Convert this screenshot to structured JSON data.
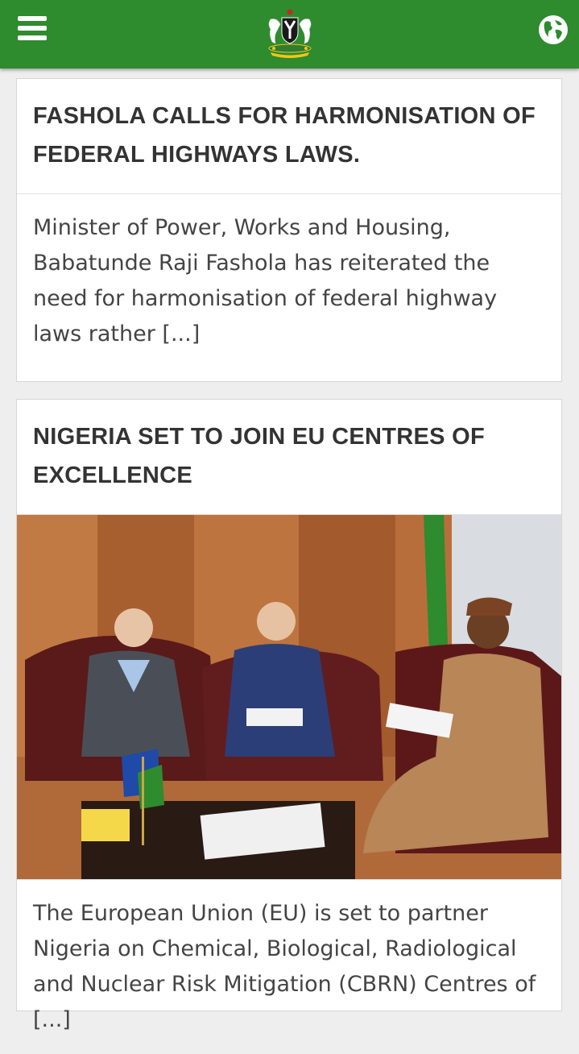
{
  "header": {
    "menu_icon": "hamburger-menu-icon",
    "logo": "nigeria-coat-of-arms-logo",
    "language_icon": "globe-icon",
    "brand_color": "#2e8b2e"
  },
  "articles": [
    {
      "title": "FASHOLA CALLS FOR HARMONISATION OF FEDERAL HIGHWAYS LAWS.",
      "excerpt": "Minister of Power, Works and Housing, Babatunde Raji Fashola has reiterated the need for harmonisation of federal highway laws rather [...]"
    },
    {
      "title": "NIGERIA SET TO JOIN EU CENTRES OF EXCELLENCE",
      "image": "photo-officials-meeting-in-office",
      "excerpt": "The European Union (EU) is set to partner Nigeria on Chemical, Biological, Radiological and Nuclear Risk Mitigation (CBRN) Centres of [...]"
    }
  ]
}
